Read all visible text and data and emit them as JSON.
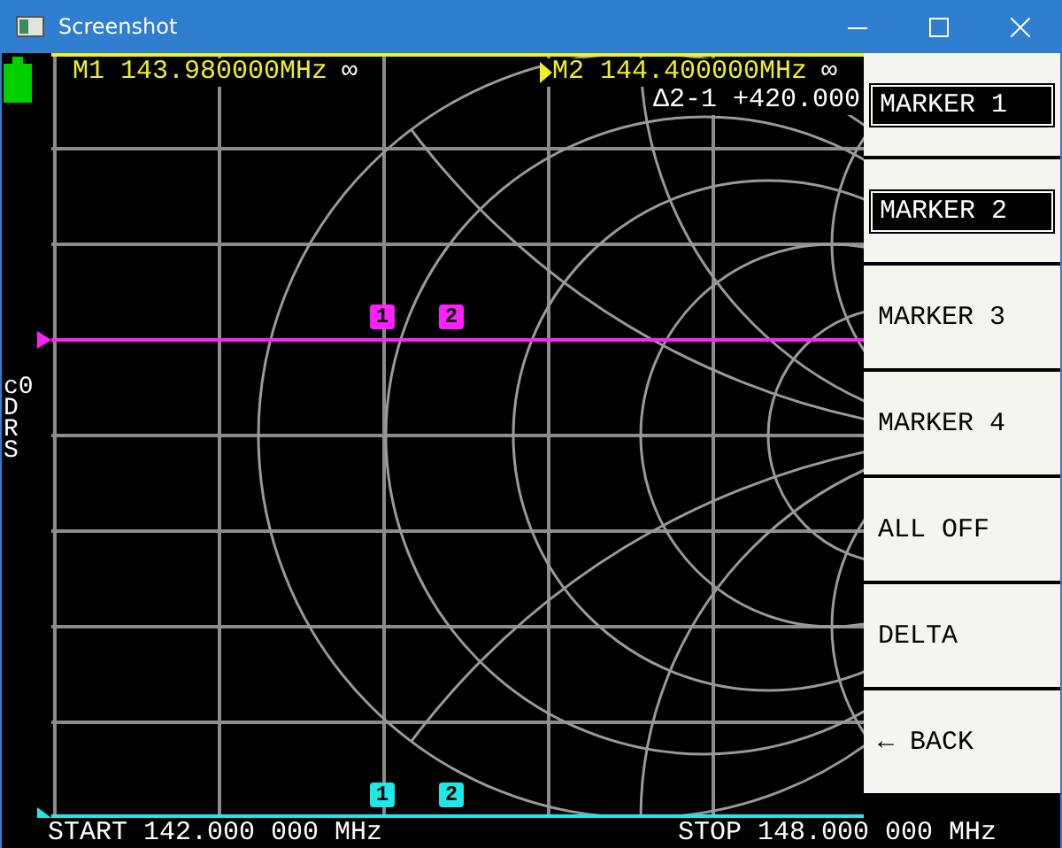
{
  "window": {
    "title": "Screenshot"
  },
  "marker_readouts": [
    {
      "label": "M1 143.980000MHz",
      "symbol": "∞",
      "active": false
    },
    {
      "label": "M2 144.400000MHz",
      "symbol": "∞",
      "active": true
    }
  ],
  "delta": "Δ2-1 +420.000",
  "channel_labels": [
    "c0",
    "D",
    "R",
    "S"
  ],
  "smith_markers": [
    {
      "label": "1"
    },
    {
      "label": "2"
    }
  ],
  "bottom_markers": [
    {
      "label": "1"
    },
    {
      "label": "2"
    }
  ],
  "menu": [
    {
      "label": "MARKER 1",
      "selected": true
    },
    {
      "label": "MARKER 2",
      "selected": true
    },
    {
      "label": "MARKER 3",
      "selected": false
    },
    {
      "label": "MARKER 4",
      "selected": false
    },
    {
      "label": "ALL OFF",
      "selected": false
    },
    {
      "label": "DELTA",
      "selected": false
    },
    {
      "label": "← BACK",
      "selected": false
    }
  ],
  "start": "START 142.000 000 MHz",
  "stop": "STOP 148.000 000 MHz"
}
